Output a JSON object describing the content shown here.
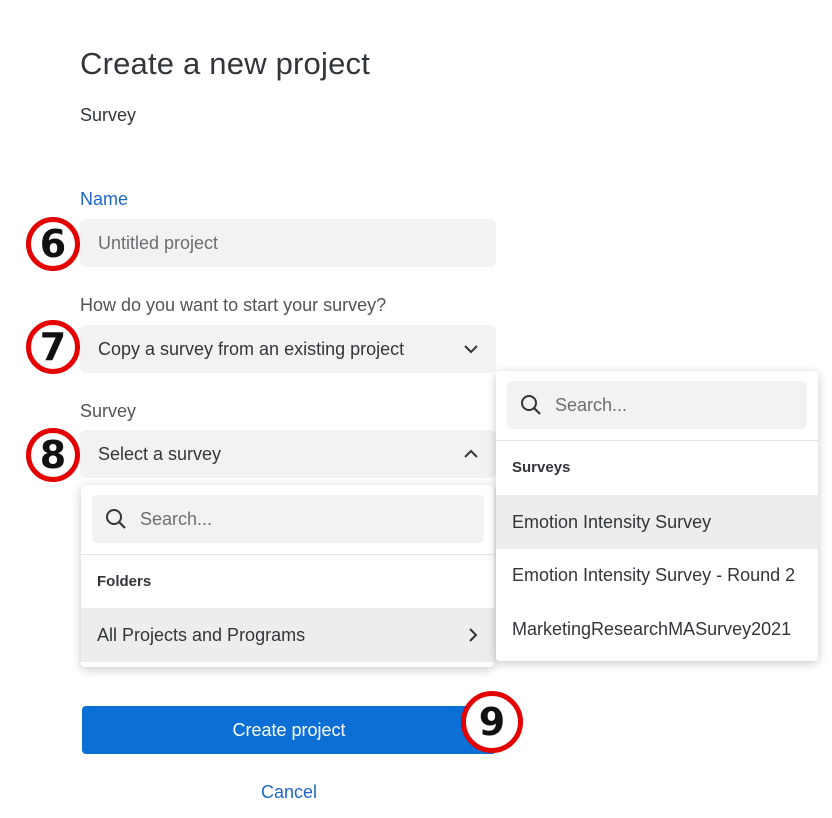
{
  "header": {
    "title": "Create a new project",
    "subtitle": "Survey"
  },
  "name_field": {
    "label": "Name",
    "placeholder": "Untitled project"
  },
  "start_field": {
    "label": "How do you want to start your survey?",
    "value": "Copy a survey from an existing project"
  },
  "survey_field": {
    "label": "Survey",
    "value": "Select a survey"
  },
  "folders_dropdown": {
    "search_placeholder": "Search...",
    "section_label": "Folders",
    "items": [
      {
        "label": "All Projects and Programs"
      }
    ]
  },
  "surveys_dropdown": {
    "search_placeholder": "Search...",
    "section_label": "Surveys",
    "items": [
      {
        "label": "Emotion Intensity Survey"
      },
      {
        "label": "Emotion Intensity Survey - Round 2"
      },
      {
        "label": "MarketingResearchMASurvey2021"
      }
    ]
  },
  "actions": {
    "create_label": "Create project",
    "cancel_label": "Cancel"
  },
  "step_badges": [
    "6",
    "7",
    "8",
    "9"
  ],
  "colors": {
    "accent": "#0b6fd6",
    "link": "#1d66c9",
    "badge": "#e40000",
    "field_bg": "#f2f2f2"
  },
  "icons": [
    "search-icon",
    "chevron-down-icon",
    "chevron-up-icon",
    "chevron-right-icon"
  ]
}
